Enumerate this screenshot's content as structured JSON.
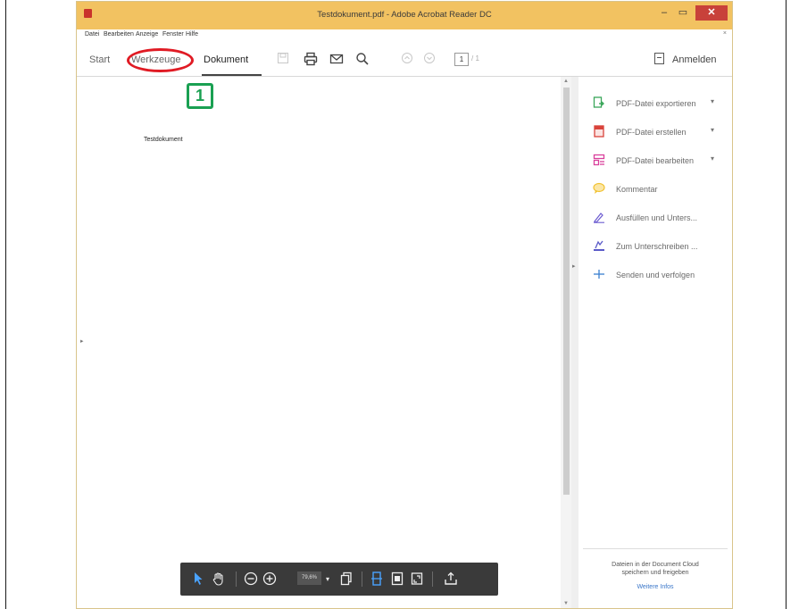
{
  "window": {
    "title": "Testdokument.pdf - Adobe Acrobat Reader DC",
    "controls": {
      "minimize": "–",
      "maximize": "▭",
      "close": "✕"
    }
  },
  "menu": {
    "items": [
      "Datei",
      "Bearbeiten",
      "Anzeige",
      "Fenster",
      "Hilfe"
    ],
    "collapse": "×"
  },
  "toolbar": {
    "tabs": {
      "start": "Start",
      "werkzeuge": "Werkzeuge",
      "dokument": "Dokument"
    },
    "page_current": "1",
    "page_total": "/ 1",
    "signin": "Anmelden",
    "icons": [
      "save-icon",
      "print-icon",
      "email-icon",
      "search-icon",
      "page-up-icon",
      "page-down-icon",
      "signin-icon"
    ]
  },
  "document": {
    "text": "Testdokument"
  },
  "annotation": {
    "badge": "1",
    "highlight_color": "#e01b24",
    "badge_color": "#1aa052"
  },
  "tools_pane": {
    "items": [
      {
        "label": "PDF-Datei exportieren",
        "icon": "export-pdf-icon",
        "color": "#3aa65a",
        "chevron": "▾"
      },
      {
        "label": "PDF-Datei erstellen",
        "icon": "create-pdf-icon",
        "color": "#d9433b",
        "chevron": "▾"
      },
      {
        "label": "PDF-Datei bearbeiten",
        "icon": "edit-pdf-icon",
        "color": "#d9409c",
        "chevron": "▾"
      },
      {
        "label": "Kommentar",
        "icon": "comment-icon",
        "color": "#f1c232",
        "chevron": ""
      },
      {
        "label": "Ausfüllen und Unters...",
        "icon": "fill-sign-icon",
        "color": "#6b5bd0",
        "chevron": ""
      },
      {
        "label": "Zum Unterschreiben ...",
        "icon": "send-sign-icon",
        "color": "#5a5ac8",
        "chevron": ""
      },
      {
        "label": "Senden und verfolgen",
        "icon": "send-track-icon",
        "color": "#3a7fd0",
        "chevron": ""
      }
    ],
    "cloud_text_line1": "Dateien in der Document Cloud",
    "cloud_text_line2": "speichern und freigeben",
    "cloud_link": "Weitere Infos"
  },
  "float_toolbar": {
    "zoom": "79,6%",
    "icons": [
      "select-arrow-icon",
      "hand-tool-icon",
      "zoom-out-icon",
      "zoom-in-icon",
      "zoom-dropdown-icon",
      "page-fit-icon",
      "scroll-mode-icon",
      "fit-page-icon",
      "fullscreen-icon",
      "share-icon"
    ]
  }
}
